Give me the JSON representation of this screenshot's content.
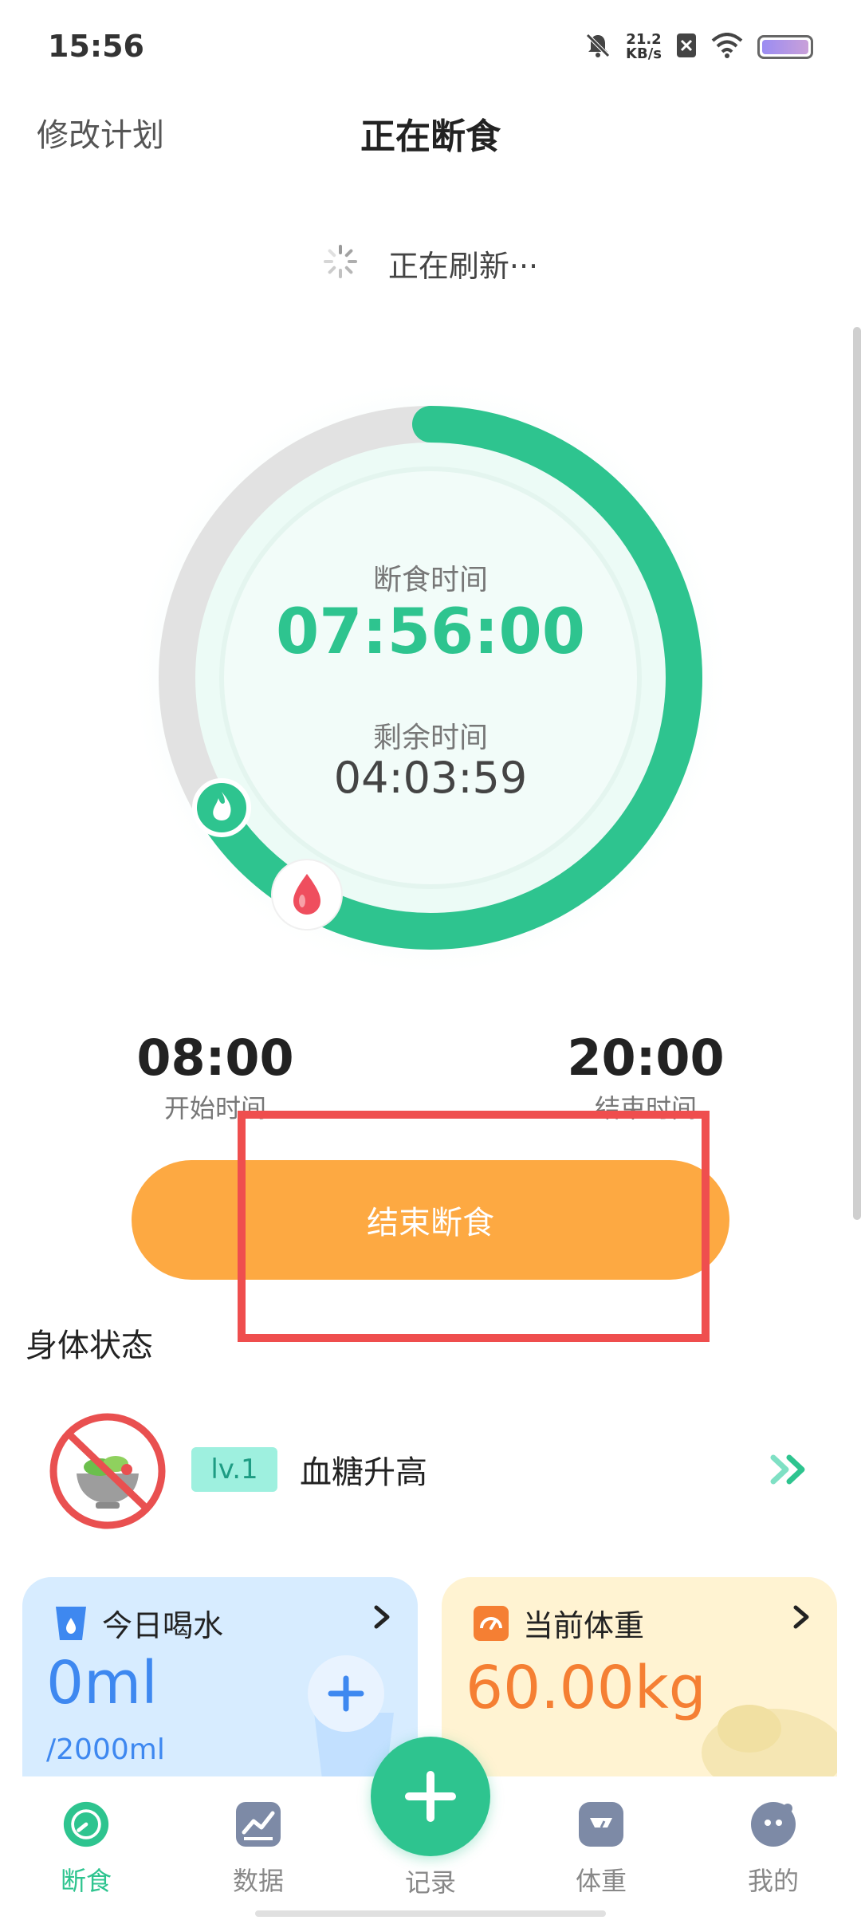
{
  "status_bar": {
    "time": "15:56",
    "net_speed_value": "21.2",
    "net_speed_unit": "KB/s"
  },
  "header": {
    "left_action": "修改计划",
    "title": "正在断食"
  },
  "refresh": {
    "text": "正在刷新···"
  },
  "fasting_ring": {
    "elapsed_label": "断食时间",
    "elapsed_value": "07:56:00",
    "remaining_label": "剩余时间",
    "remaining_value": "04:03:59",
    "progress_fraction": 0.66
  },
  "schedule": {
    "start_time": "08:00",
    "start_label": "开始时间",
    "end_time": "20:00",
    "end_label": "结束时间"
  },
  "end_button": {
    "label": "结束断食"
  },
  "body_status": {
    "section_title": "身体状态",
    "level": "lv.1",
    "description": "血糖升高"
  },
  "cards": {
    "water": {
      "title": "今日喝水",
      "value": "0ml",
      "goal": "/2000ml"
    },
    "weight": {
      "title": "当前体重",
      "value": "60.00kg"
    }
  },
  "tabbar": {
    "items": [
      {
        "label": "断食",
        "icon": "fasting-gauge-icon"
      },
      {
        "label": "数据",
        "icon": "chart-icon"
      },
      {
        "label": "记录",
        "icon": "plus-icon"
      },
      {
        "label": "体重",
        "icon": "scale-icon"
      },
      {
        "label": "我的",
        "icon": "profile-icon"
      }
    ]
  },
  "colors": {
    "accent_green": "#2ec48f",
    "button_orange": "#fda942",
    "water_blue": "#3e88f0",
    "weight_orange": "#f57f33",
    "highlight_red": "#ef4e4e"
  }
}
